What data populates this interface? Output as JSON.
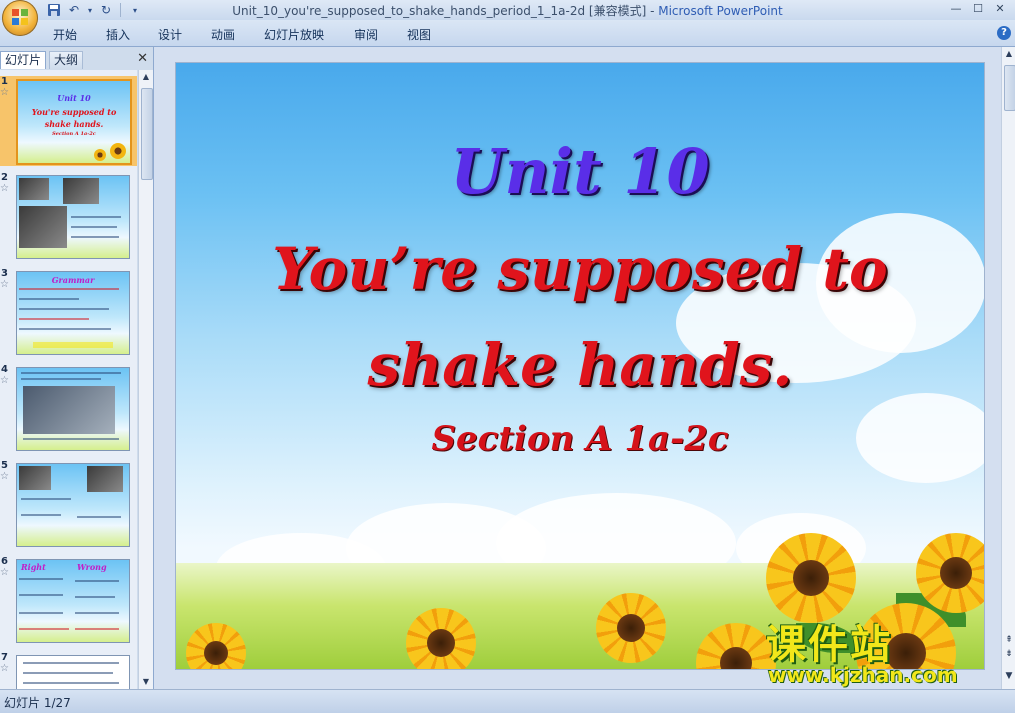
{
  "window": {
    "title_doc": "Unit_10_you're_supposed_to_shake_hands_period_1_1a-2d [兼容模式] - ",
    "title_app": "Microsoft PowerPoint"
  },
  "ribbon": {
    "tabs": [
      "开始",
      "插入",
      "设计",
      "动画",
      "幻灯片放映",
      "审阅",
      "视图"
    ],
    "help": "?"
  },
  "left_pane": {
    "tab_slides": "幻灯片",
    "tab_outline": "大纲",
    "close": "✕",
    "slides": [
      {
        "num": "1",
        "mini_title": "Unit 10",
        "mini_line1": "You're supposed to",
        "mini_line2": "shake hands.",
        "mini_sub": "Section A 1a-2c"
      },
      {
        "num": "2"
      },
      {
        "num": "3",
        "mini_title": "Grammar"
      },
      {
        "num": "4"
      },
      {
        "num": "5"
      },
      {
        "num": "6",
        "mini_right": "Right",
        "mini_wrong": "Wrong"
      },
      {
        "num": "7"
      }
    ]
  },
  "slide": {
    "title": "Unit 10",
    "line1": "You’re supposed to",
    "line2": "shake hands.",
    "section": "Section A 1a-2c"
  },
  "watermark": {
    "brand": "课件站",
    "url": "www.kjzhan.com"
  },
  "status": {
    "slide_counter": "幻灯片 1/27"
  }
}
